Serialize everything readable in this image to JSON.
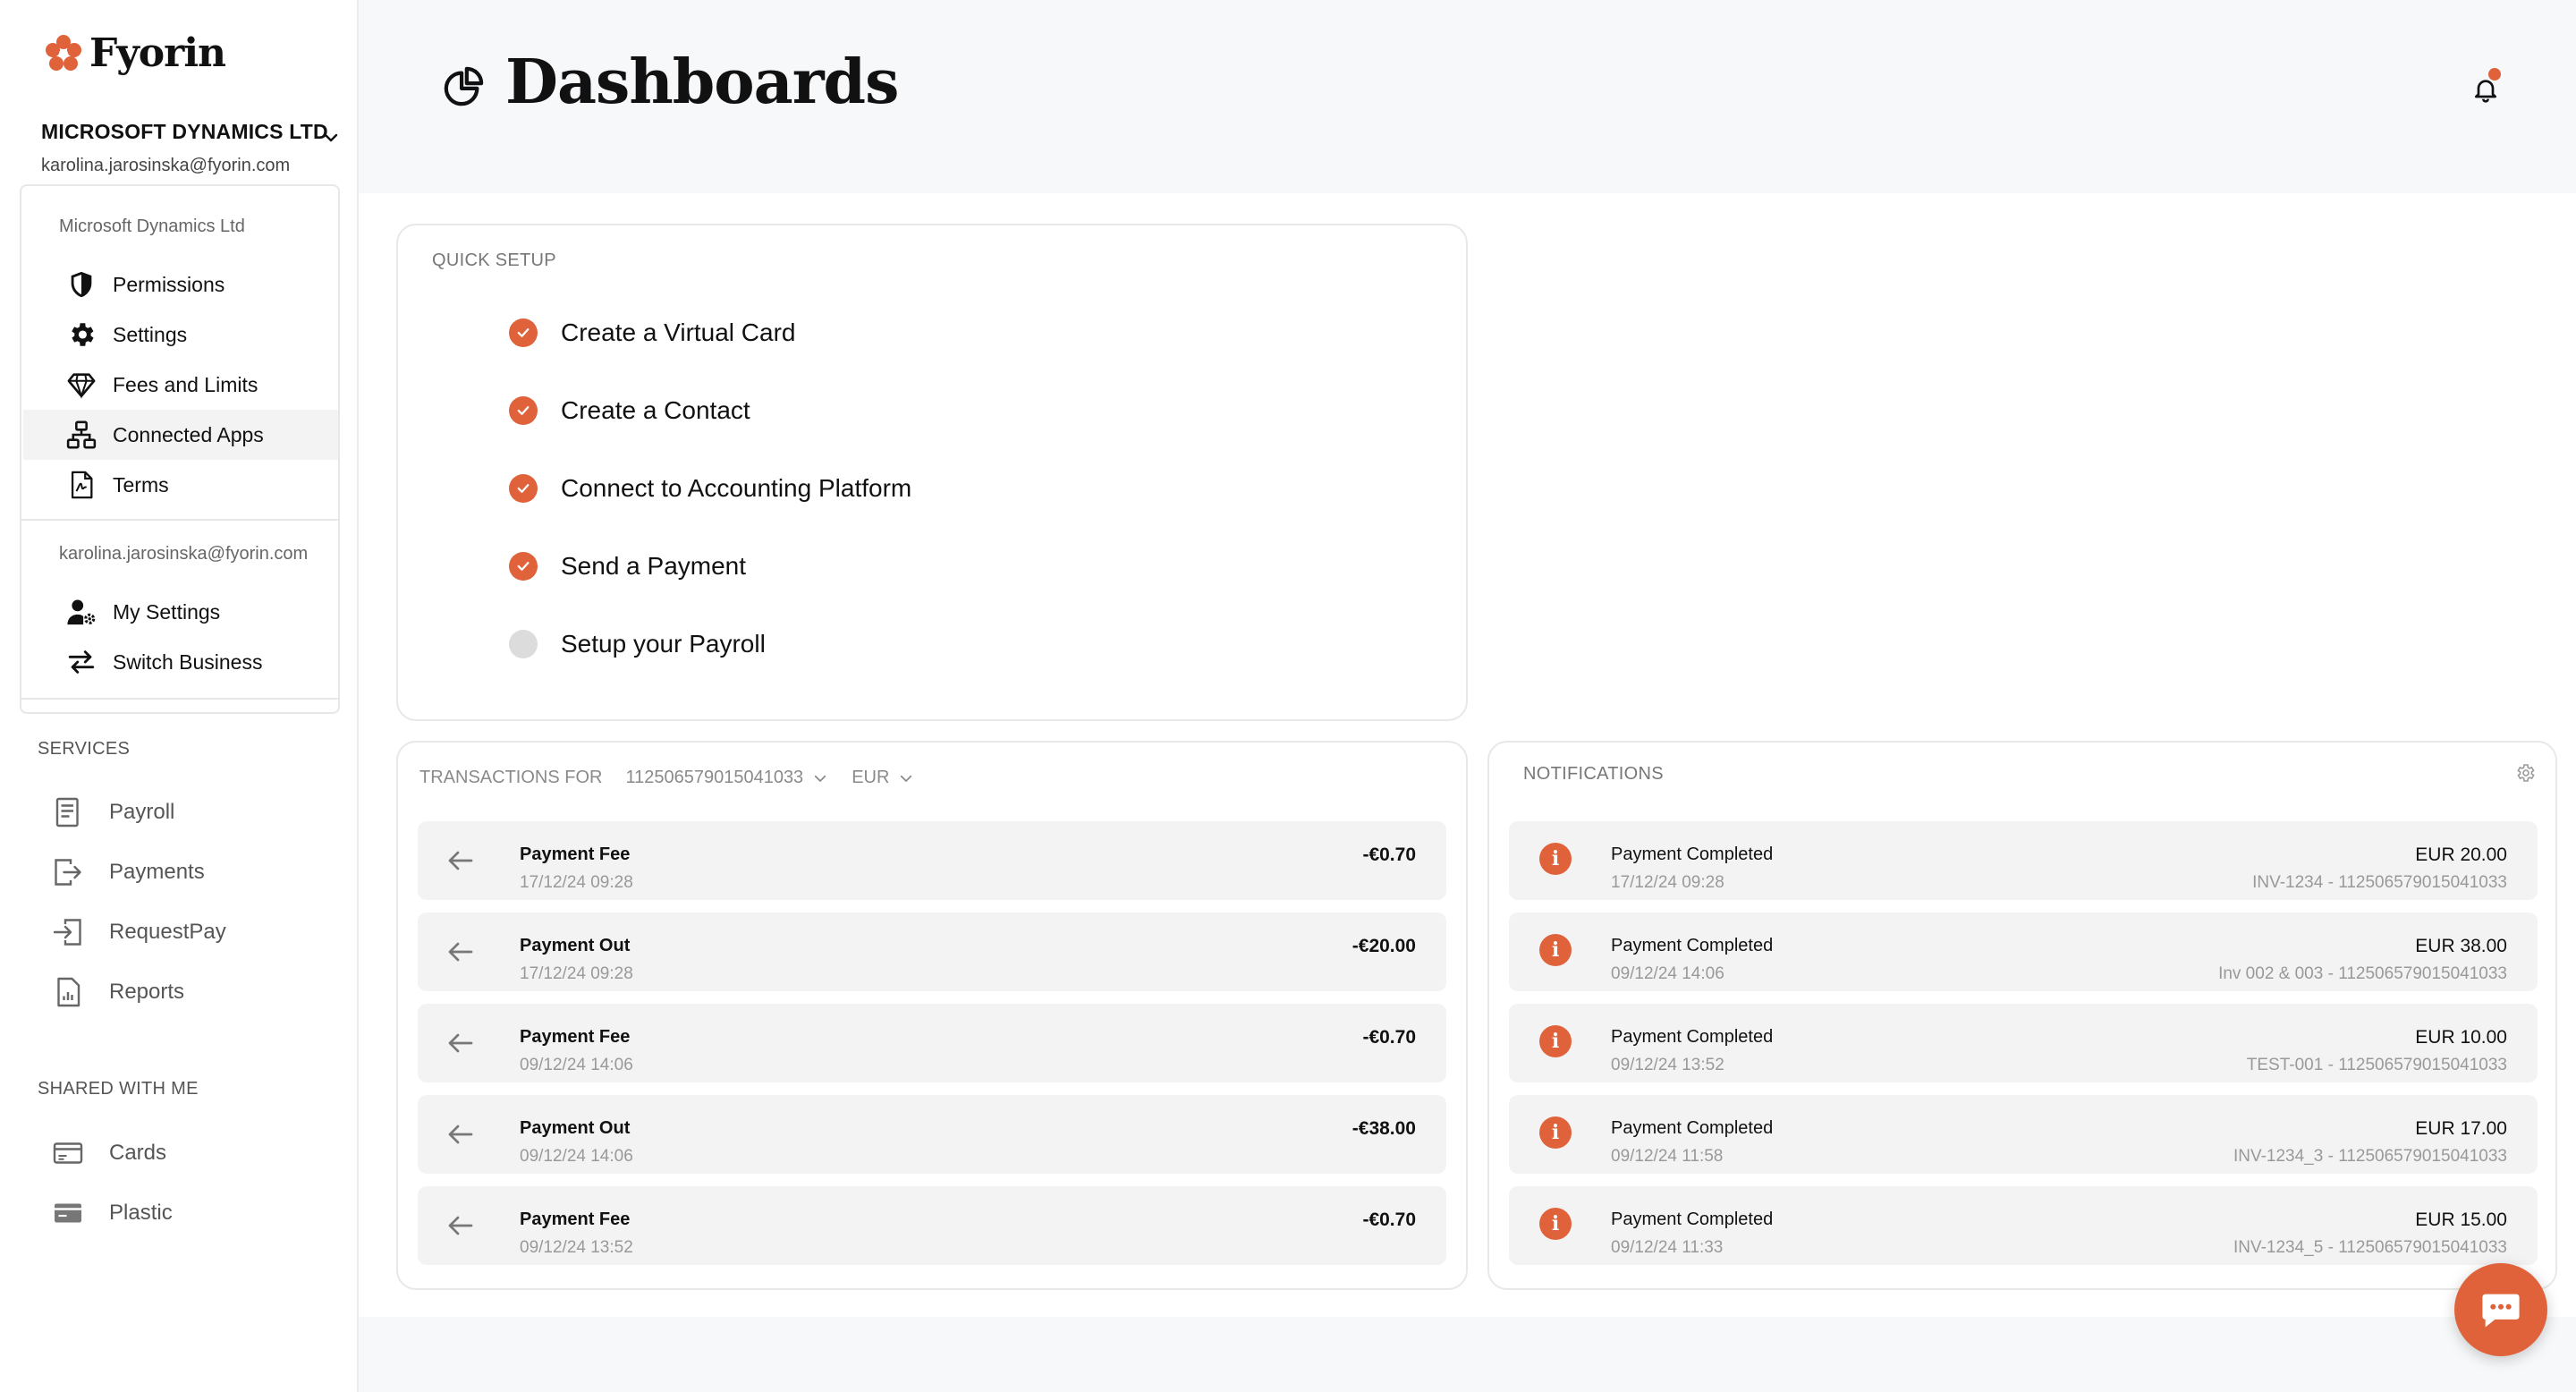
{
  "brand": {
    "name": "Fyorin",
    "accent": "#e0623a"
  },
  "account": {
    "company": "MICROSOFT DYNAMICS LTD",
    "email": "karolina.jarosinska@fyorin.com"
  },
  "account_menu": {
    "business_heading": "Microsoft Dynamics Ltd",
    "business_items": [
      {
        "label": "Permissions",
        "icon": "shield-icon"
      },
      {
        "label": "Settings",
        "icon": "gear-icon"
      },
      {
        "label": "Fees and Limits",
        "icon": "diamond-icon"
      },
      {
        "label": "Connected Apps",
        "icon": "network-icon"
      },
      {
        "label": "Terms",
        "icon": "document-icon"
      }
    ],
    "user_heading": "karolina.jarosinska@fyorin.com",
    "user_items": [
      {
        "label": "My Settings",
        "icon": "user-settings-icon"
      },
      {
        "label": "Switch Business",
        "icon": "switch-icon"
      }
    ]
  },
  "nav": {
    "services_label": "SERVICES",
    "services": [
      {
        "label": "Payroll",
        "icon": "payroll-icon"
      },
      {
        "label": "Payments",
        "icon": "payments-icon"
      },
      {
        "label": "RequestPay",
        "icon": "request-pay-icon"
      },
      {
        "label": "Reports",
        "icon": "reports-icon"
      }
    ],
    "shared_label": "SHARED WITH ME",
    "shared": [
      {
        "label": "Cards",
        "icon": "card-icon"
      },
      {
        "label": "Plastic",
        "icon": "plastic-card-icon"
      }
    ]
  },
  "header": {
    "title": "Dashboards"
  },
  "quick_setup": {
    "label": "QUICK SETUP",
    "items": [
      {
        "label": "Create a Virtual Card",
        "done": true
      },
      {
        "label": "Create a Contact",
        "done": true
      },
      {
        "label": "Connect to Accounting Platform",
        "done": true
      },
      {
        "label": "Send a Payment",
        "done": true
      },
      {
        "label": "Setup your Payroll",
        "done": false
      }
    ]
  },
  "transactions": {
    "label": "TRANSACTIONS FOR",
    "account_number": "112506579015041033",
    "currency": "EUR",
    "rows": [
      {
        "title": "Payment Fee",
        "date": "17/12/24 09:28",
        "amount": "-€0.70"
      },
      {
        "title": "Payment Out",
        "date": "17/12/24 09:28",
        "amount": "-€20.00"
      },
      {
        "title": "Payment Fee",
        "date": "09/12/24 14:06",
        "amount": "-€0.70"
      },
      {
        "title": "Payment Out",
        "date": "09/12/24 14:06",
        "amount": "-€38.00"
      },
      {
        "title": "Payment Fee",
        "date": "09/12/24 13:52",
        "amount": "-€0.70"
      }
    ]
  },
  "notifications": {
    "label": "NOTIFICATIONS",
    "rows": [
      {
        "title": "Payment Completed",
        "date": "17/12/24 09:28",
        "amount": "EUR 20.00",
        "ref": "INV-1234 - 112506579015041033"
      },
      {
        "title": "Payment Completed",
        "date": "09/12/24 14:06",
        "amount": "EUR 38.00",
        "ref": "Inv 002 & 003 - 112506579015041033"
      },
      {
        "title": "Payment Completed",
        "date": "09/12/24 13:52",
        "amount": "EUR 10.00",
        "ref": "TEST-001 - 112506579015041033"
      },
      {
        "title": "Payment Completed",
        "date": "09/12/24 11:58",
        "amount": "EUR 17.00",
        "ref": "INV-1234_3 - 112506579015041033"
      },
      {
        "title": "Payment Completed",
        "date": "09/12/24 11:33",
        "amount": "EUR 15.00",
        "ref": "INV-1234_5 - 112506579015041033"
      }
    ]
  }
}
